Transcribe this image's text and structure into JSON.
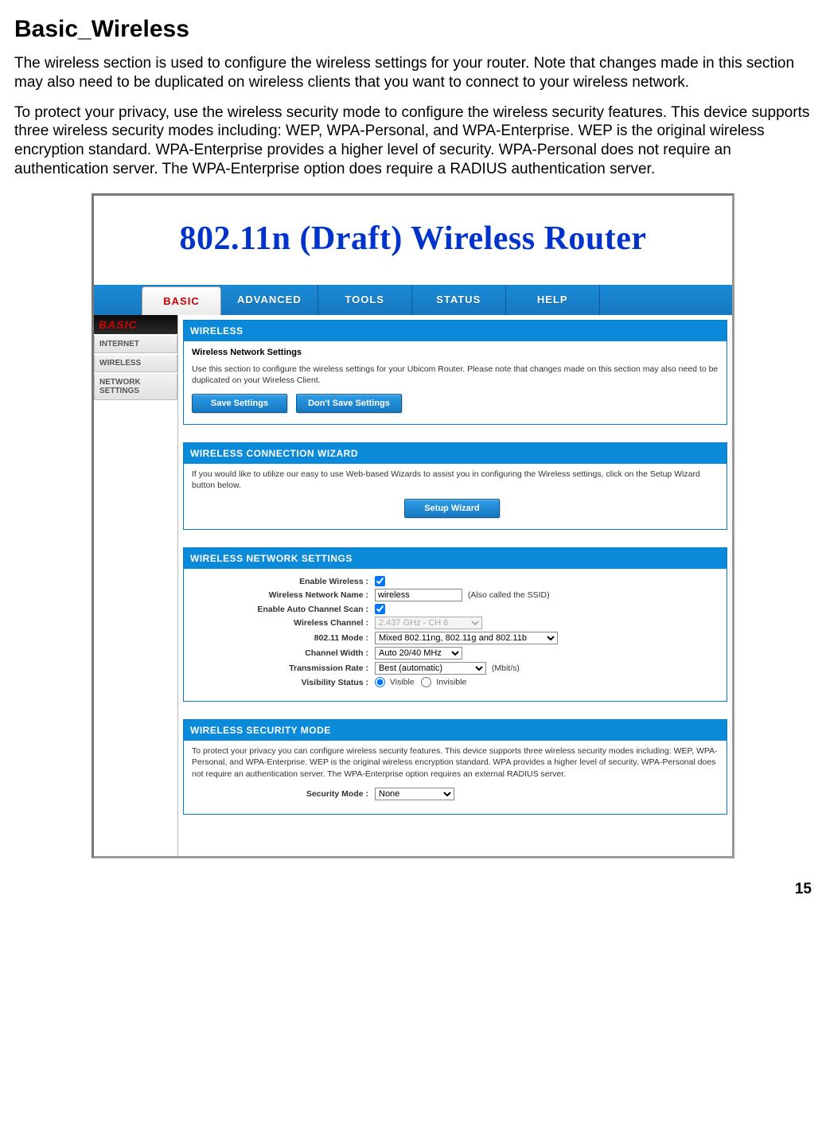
{
  "doc": {
    "title": "Basic_Wireless",
    "intro1": "The wireless section is used to configure the wireless settings for your router. Note that changes made in this section may also need to be duplicated on wireless clients that you want to connect to your wireless network.",
    "intro2": "To protect your privacy, use the wireless security mode to configure the wireless security features. This device supports three wireless security modes including: WEP, WPA-Personal, and WPA-Enterprise. WEP is the original wireless encryption standard. WPA-Enterprise provides a higher level of security. WPA-Personal does not require an authentication server. The WPA-Enterprise option does require a RADIUS authentication server.",
    "page_num": "15"
  },
  "banner": {
    "title": "802.11n (Draft) Wireless Router"
  },
  "tabs": {
    "basic": "BASIC",
    "advanced": "ADVANCED",
    "tools": "TOOLS",
    "status": "STATUS",
    "help": "HELP"
  },
  "sidebar": {
    "title": "BASIC",
    "items": {
      "internet": "INTERNET",
      "wireless": "WIRELESS",
      "network": "NETWORK SETTINGS"
    }
  },
  "panel_wireless": {
    "title": "WIRELESS",
    "subtitle": "Wireless Network Settings",
    "desc": "Use this section to configure the wireless settings for your Ubicom Router. Please note that changes made on this section may also need to be duplicated on your Wireless Client.",
    "save_btn": "Save Settings",
    "dont_save_btn": "Don't Save Settings"
  },
  "panel_wizard": {
    "title": "WIRELESS CONNECTION WIZARD",
    "desc": "If you would like to utilize our easy to use Web-based Wizards to assist you in configuring the Wireless settings, click on the Setup Wizard button below.",
    "btn": "Setup Wizard"
  },
  "panel_settings": {
    "title": "WIRELESS NETWORK SETTINGS",
    "labels": {
      "enable_wireless": "Enable Wireless :",
      "ssid": "Wireless Network Name :",
      "auto_scan": "Enable Auto Channel Scan :",
      "channel": "Wireless Channel :",
      "mode": "802.11 Mode :",
      "width": "Channel Width :",
      "rate": "Transmission Rate :",
      "visibility": "Visibility Status :"
    },
    "values": {
      "ssid": "wireless",
      "ssid_hint": "(Also called the SSID)",
      "channel": "2.437 GHz - CH 6",
      "mode": "Mixed 802.11ng, 802.11g and 802.11b",
      "width": "Auto 20/40 MHz",
      "rate": "Best (automatic)",
      "rate_hint": "(Mbit/s)",
      "visible": "Visible",
      "invisible": "Invisible"
    }
  },
  "panel_security": {
    "title": "WIRELESS SECURITY MODE",
    "desc": "To protect your privacy you can configure wireless security features. This device supports three wireless security modes including: WEP, WPA-Personal, and WPA-Enterprise. WEP is the original wireless encryption standard. WPA provides a higher level of security. WPA-Personal does not require an authentication server. The WPA-Enterprise option requires an external RADIUS server.",
    "label": "Security Mode :",
    "value": "None"
  }
}
